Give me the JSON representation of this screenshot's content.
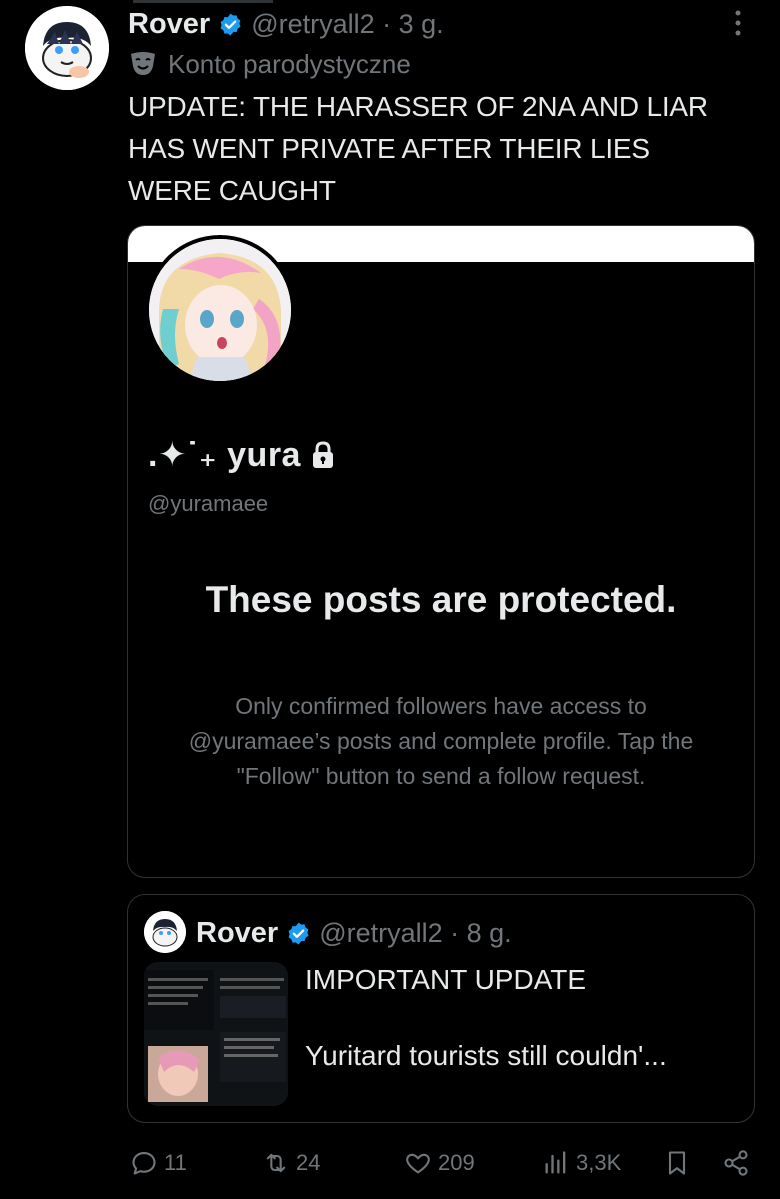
{
  "tweet": {
    "author_name": "Rover",
    "handle_time": "@retryall2 · 3 g.",
    "parody_label": "Konto parodystyczne",
    "text": "UPDATE: THE HARASSER OF 2NA AND LIAR\nHAS WENT PRIVATE AFTER THEIR LIES\nWERE CAUGHT"
  },
  "profile_card": {
    "display_name": ".✦˙₊ yura",
    "handle": "@yuramaee",
    "protected_title": "These posts are protected.",
    "protected_body": "Only confirmed followers have access to @yuramaee’s posts and complete profile. Tap the \"Follow\" button to send a follow request."
  },
  "quote": {
    "author_name": "Rover",
    "handle_time": "@retryall2 · 8 g.",
    "text": "IMPORTANT UPDATE\n\nYuritard tourists still couldn'..."
  },
  "actions": {
    "replies": "11",
    "reposts": "24",
    "likes": "209",
    "views": "3,3K"
  },
  "colors": {
    "background": "#000000",
    "text": "#e7e9ea",
    "muted": "#71767b",
    "verified": "#1d9bf0",
    "border": "#2f3336"
  },
  "icons": [
    "verified-badge-icon",
    "more-icon",
    "parody-mask-icon",
    "lock-icon",
    "reply-icon",
    "repost-icon",
    "like-icon",
    "views-icon",
    "bookmark-icon",
    "share-icon"
  ]
}
